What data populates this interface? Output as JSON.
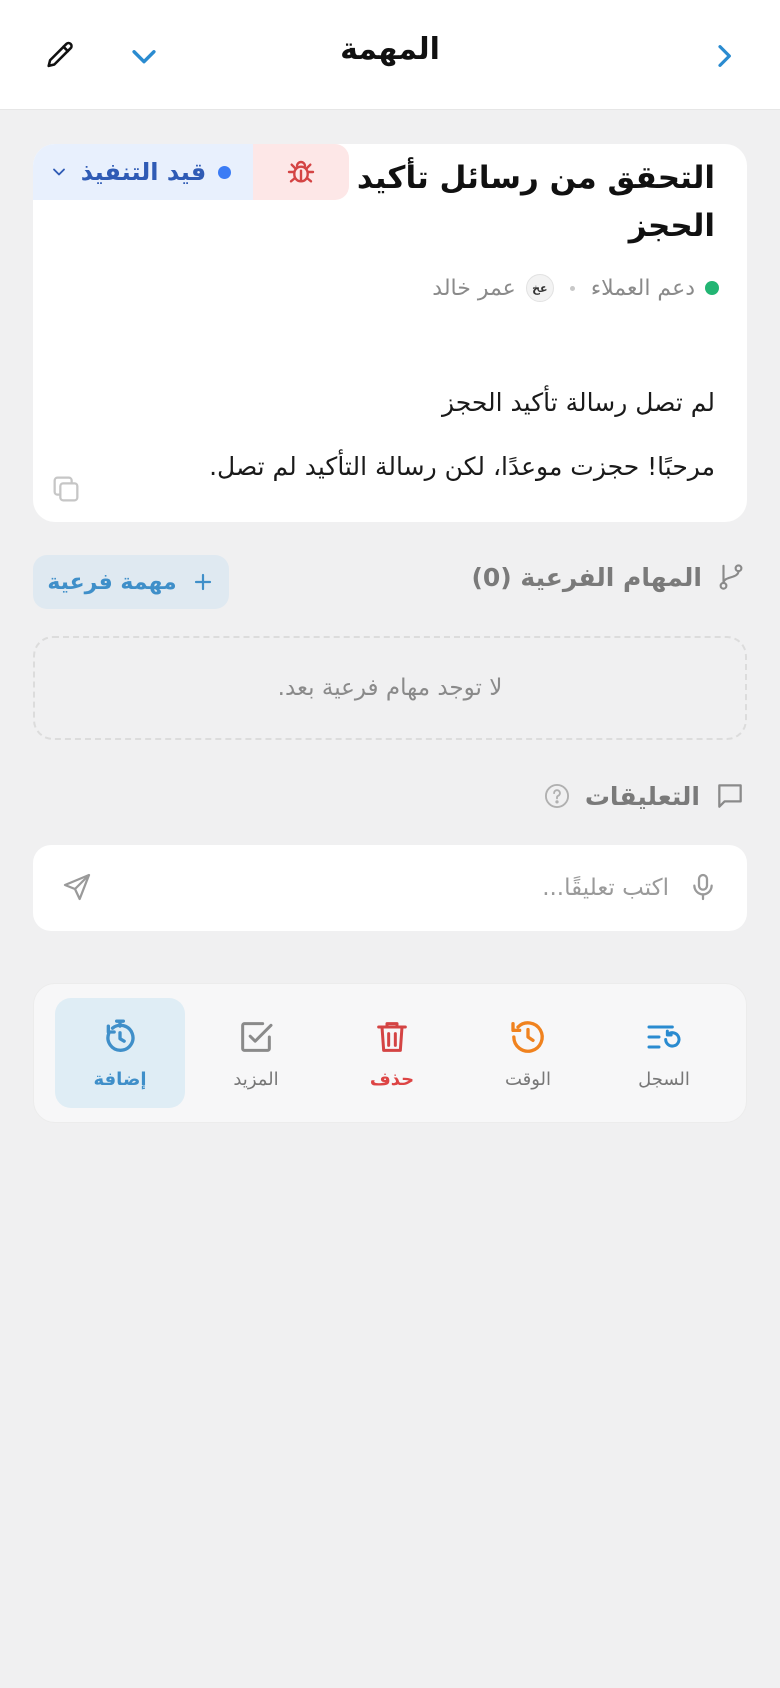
{
  "header": {
    "title": "المهمة"
  },
  "task": {
    "title": "التحقق من رسائل تأكيد الحجز",
    "status": "قيد التنفيذ",
    "team": "دعم العملاء",
    "assignee_initials": "عخ",
    "assignee": "عمر خالد",
    "description_heading": "لم تصل رسالة تأكيد الحجز",
    "description_body": "مرحبًا! حجزت موعدًا، لكن رسالة التأكيد لم تصل."
  },
  "subtasks": {
    "title": "المهام الفرعية (0)",
    "add_label": "مهمة فرعية",
    "empty_text": "لا توجد مهام فرعية بعد."
  },
  "comments": {
    "title": "التعليقات",
    "placeholder": "اكتب تعليقًا..."
  },
  "toolbar": {
    "items": [
      {
        "label": "السجل",
        "icon": "history-log-icon"
      },
      {
        "label": "الوقت",
        "icon": "time-history-icon"
      },
      {
        "label": "حذف",
        "icon": "trash-icon"
      },
      {
        "label": "المزيد",
        "icon": "checkbox-icon"
      },
      {
        "label": "إضافة",
        "icon": "timer-icon"
      }
    ]
  },
  "colors": {
    "accent": "#3f8fc9",
    "status_blue": "#3b7cf5",
    "danger": "#d44444",
    "team_green": "#22b573",
    "time_orange": "#f0821e"
  }
}
